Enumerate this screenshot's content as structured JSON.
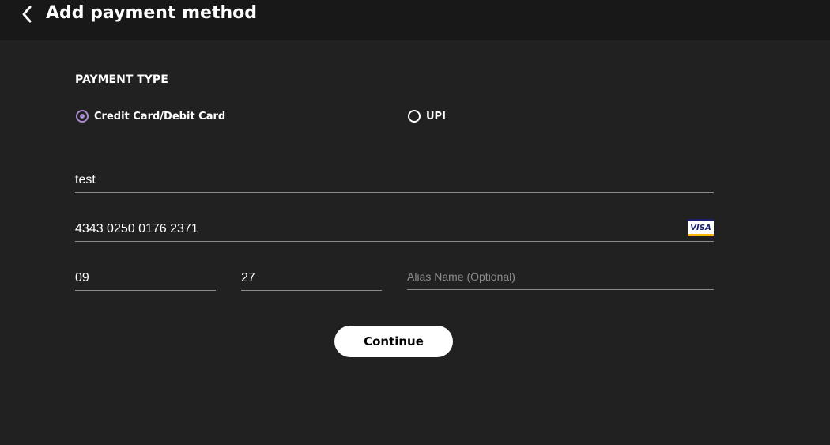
{
  "header": {
    "title": "Add payment method",
    "back_icon": "chevron-left-icon"
  },
  "payment_type": {
    "label": "PAYMENT TYPE",
    "options": [
      {
        "label": "Credit Card/Debit Card",
        "selected": true
      },
      {
        "label": "UPI",
        "selected": false
      }
    ],
    "accent_color": "#a98bd0"
  },
  "form": {
    "name_value": "test",
    "card_number_value": "4343 0250 0176 2371",
    "card_brand": "VISA",
    "expiry_month_value": "09",
    "expiry_year_value": "27",
    "alias_value": "",
    "alias_placeholder": "Alias Name (Optional)"
  },
  "actions": {
    "continue_label": "Continue"
  },
  "colors": {
    "background": "#212121",
    "topbar": "#181818",
    "button_bg": "#ffffff"
  }
}
